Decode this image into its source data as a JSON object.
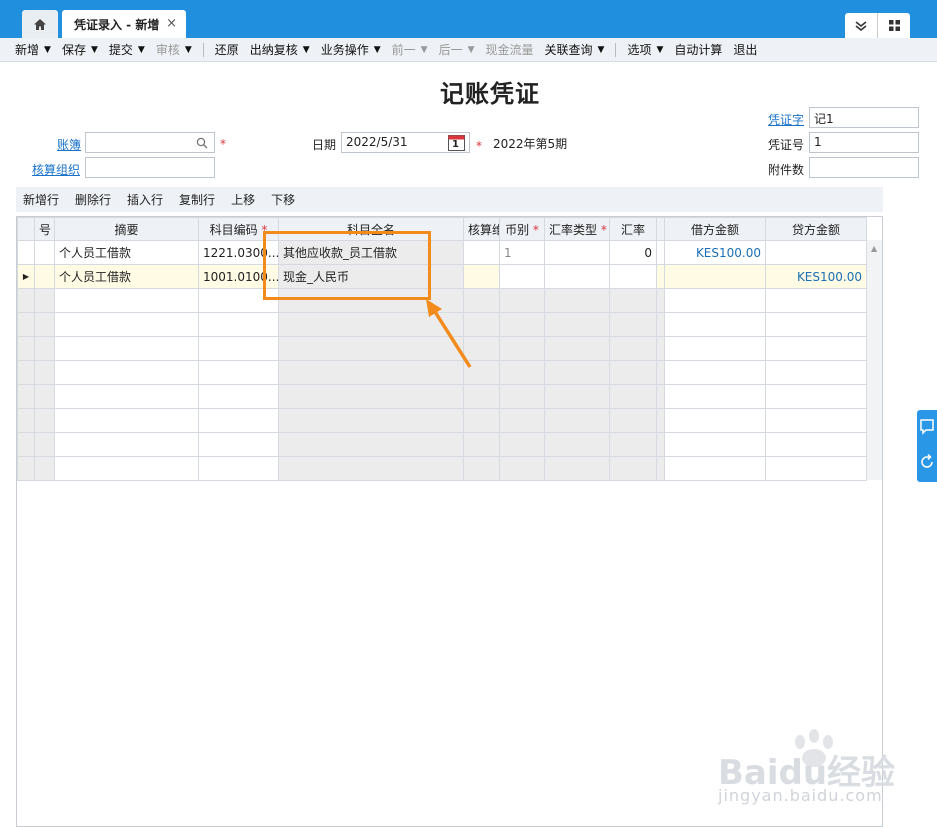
{
  "tabs": {
    "active_label": "凭证录入 - 新增",
    "close": "×"
  },
  "menu": {
    "items": [
      {
        "label": "新增",
        "caret": true,
        "disabled": false
      },
      {
        "label": "保存",
        "caret": true,
        "disabled": false
      },
      {
        "label": "提交",
        "caret": true,
        "disabled": false
      },
      {
        "label": "审核",
        "caret": true,
        "disabled": true
      },
      {
        "label": "还原",
        "caret": false,
        "disabled": false
      },
      {
        "label": "出纳复核",
        "caret": true,
        "disabled": false
      },
      {
        "label": "业务操作",
        "caret": true,
        "disabled": false
      },
      {
        "label": "前一",
        "caret": true,
        "disabled": true
      },
      {
        "label": "后一",
        "caret": true,
        "disabled": true
      },
      {
        "label": "现金流量",
        "caret": false,
        "disabled": true
      },
      {
        "label": "关联查询",
        "caret": true,
        "disabled": false
      },
      {
        "label": "选项",
        "caret": true,
        "disabled": false
      },
      {
        "label": "自动计算",
        "caret": false,
        "disabled": false
      },
      {
        "label": "退出",
        "caret": false,
        "disabled": false
      }
    ]
  },
  "page": {
    "title": "记账凭证"
  },
  "form": {
    "account_book_label": "账簿",
    "account_book_value": "",
    "org_label": "核算组织",
    "org_value": "",
    "date_label": "日期",
    "date_value": "2022/5/31",
    "calendar_day": "1",
    "period_text": "2022年第5期",
    "voucher_word_label": "凭证字",
    "voucher_word_value": "记1",
    "voucher_no_label": "凭证号",
    "voucher_no_value": "1",
    "attachments_label": "附件数",
    "attachments_value": "",
    "required_mark": "*"
  },
  "grid_toolbar": [
    "新增行",
    "删除行",
    "插入行",
    "复制行",
    "上移",
    "下移"
  ],
  "grid": {
    "columns": {
      "seq": "号",
      "summary": "摘要",
      "account_code": "科目编码",
      "account_name": "科目全名",
      "accounting": "核算维度",
      "currency": "币别",
      "rate_type": "汇率类型",
      "rate": "汇率",
      "debit": "借方金额",
      "credit": "贷方金额"
    },
    "rows": [
      {
        "summary": "个人员工借款",
        "account_code": "1221.0300...",
        "account_name": "其他应收款_员工借款",
        "currency": "1",
        "rate": "0",
        "debit": "KES100.00",
        "credit": ""
      },
      {
        "summary": "个人员工借款",
        "account_code": "1001.0100...",
        "account_name": "现金_人民币",
        "currency": "",
        "rate": "",
        "debit": "",
        "credit": "KES100.00"
      }
    ]
  },
  "colors": {
    "topbar": "#1f8fde",
    "highlight": "#f28a1c",
    "money": "#1a6fb5"
  },
  "watermark": {
    "brand": "Baidu经验",
    "url": "jingyan.baidu.com"
  }
}
